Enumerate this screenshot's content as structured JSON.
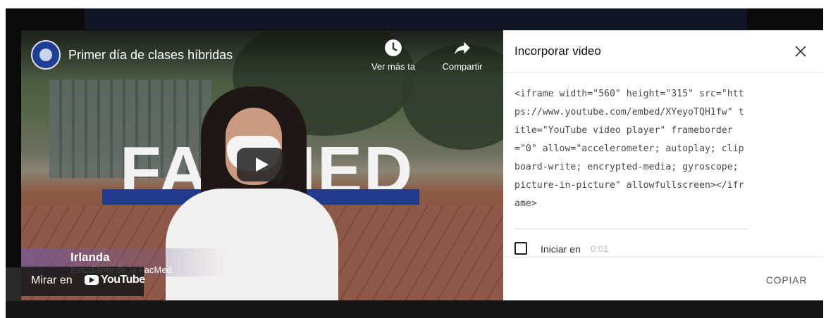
{
  "video": {
    "title": "Primer día de clases híbridas",
    "sign_text": "FACMED",
    "controls": [
      {
        "label": "Ver más ta",
        "icon": "clock-icon"
      },
      {
        "label": "Compartir",
        "icon": "share-icon"
      }
    ],
    "person_name": "Irlanda",
    "person_role": "Estudiante de la FacMed",
    "watch_on_label": "Mirar en",
    "youtube_word": "YouTube"
  },
  "embed": {
    "title": "Incorporar video",
    "code": "<iframe width=\"560\" height=\"315\" src=\"https://www.youtube.com/embed/XYeyoTQH1fw\" title=\"YouTube video player\" frameborder=\"0\" allow=\"accelerometer; autoplay; clipboard-write; encrypted-media; gyroscope; picture-in-picture\" allowfullscreen></iframe>",
    "start_label": "Iniciar en",
    "start_time": "0:01",
    "copy_label": "COPIAR"
  },
  "colors": {
    "brand_red": "#ff0000",
    "sign_base": "#203a8c"
  }
}
